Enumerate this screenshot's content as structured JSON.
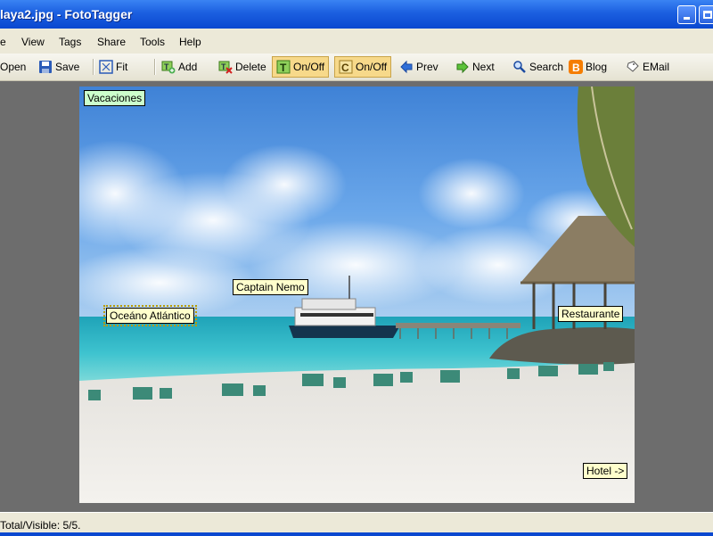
{
  "window": {
    "title": "laya2.jpg - FotoTagger"
  },
  "menu": [
    "e",
    "View",
    "Tags",
    "Share",
    "Tools",
    "Help"
  ],
  "toolbar": {
    "open": "Open",
    "save": "Save",
    "fit": "Fit",
    "add": "Add",
    "delete": "Delete",
    "toggle_tags": "On/Off",
    "toggle_comments": "On/Off",
    "prev": "Prev",
    "next": "Next",
    "search": "Search",
    "blog": "Blog",
    "email": "EMail"
  },
  "icons": {
    "open": "folder-open-icon",
    "save": "floppy-disk-icon",
    "fit": "fit-to-window-icon",
    "add": "add-tag-icon",
    "delete": "delete-tag-icon",
    "toggle_tags": "tag-visibility-icon",
    "toggle_comments": "comment-visibility-icon",
    "prev": "arrow-left-icon",
    "next": "arrow-right-icon",
    "search": "search-icon",
    "blog": "blogger-icon",
    "email": "email-icon"
  },
  "tags": [
    {
      "label": "Vacaciones",
      "style": "green"
    },
    {
      "label": "Oceáno Atlántico",
      "style": "yellow",
      "selected": true
    },
    {
      "label": "Captain Nemo",
      "style": "yellow"
    },
    {
      "label": "Restaurante",
      "style": "yellow"
    },
    {
      "label": "Hotel ->",
      "style": "yellow"
    }
  ],
  "status": {
    "text": "Total/Visible: 5/5."
  },
  "colors": {
    "titlebar": "#0a48d0",
    "workspace": "#6d6d6d",
    "tag_yellow": "#ffffcc",
    "tag_green": "#ccffcc",
    "pressed": "#f7d98a"
  }
}
